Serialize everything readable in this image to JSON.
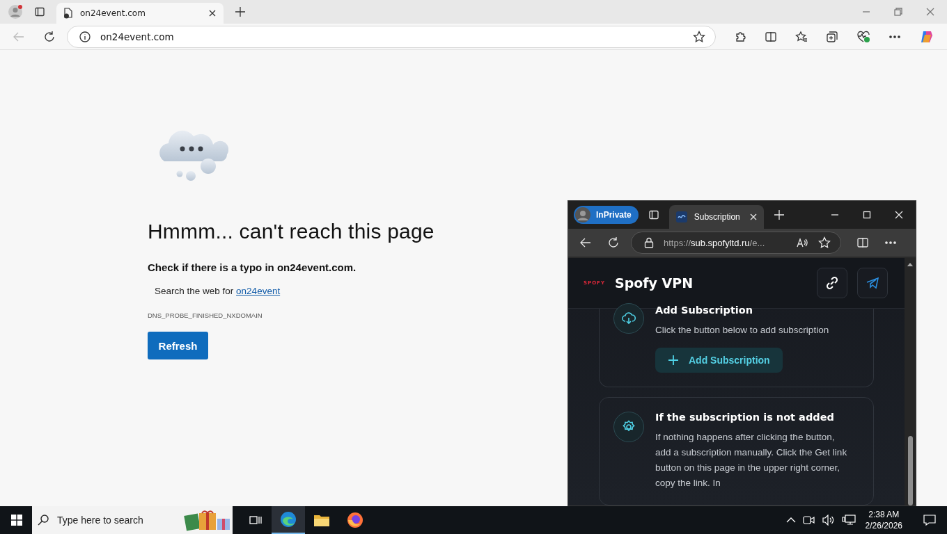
{
  "browser": {
    "tabs": [
      {
        "title": "on24event.com",
        "selected": true
      }
    ],
    "address": "on24event.com"
  },
  "error_page": {
    "title": "Hmmm... can't reach this page",
    "subtitle": "Check if there is a typo in on24event.com.",
    "search_prefix": "Search the web for",
    "search_link": "on24event",
    "error_code": "DNS_PROBE_FINISHED_NXDOMAIN",
    "button": "Refresh"
  },
  "popup": {
    "profile": "InPrivate",
    "tabs": [
      {
        "title": "Subscription",
        "selected": true
      }
    ],
    "url_scheme": "https://",
    "url_host": "sub.spofyltd.ru",
    "url_rest": "/e...",
    "logo": "SPOFY",
    "site_title": "Spofy VPN",
    "cards": [
      {
        "kind": "download",
        "title": "Add Subscription",
        "text": "Click the button below to add subscription",
        "button": "Add Subscription"
      },
      {
        "kind": "settings",
        "title": "If the subscription is not added",
        "text": "If nothing happens after clicking the button, add a subscription manually. Click the Get link button on this page in the upper right corner, copy the link. In"
      }
    ]
  },
  "taskbar": {
    "search_placeholder": "Type here to search",
    "time": "2:38 AM",
    "date": "2/26/2026"
  }
}
